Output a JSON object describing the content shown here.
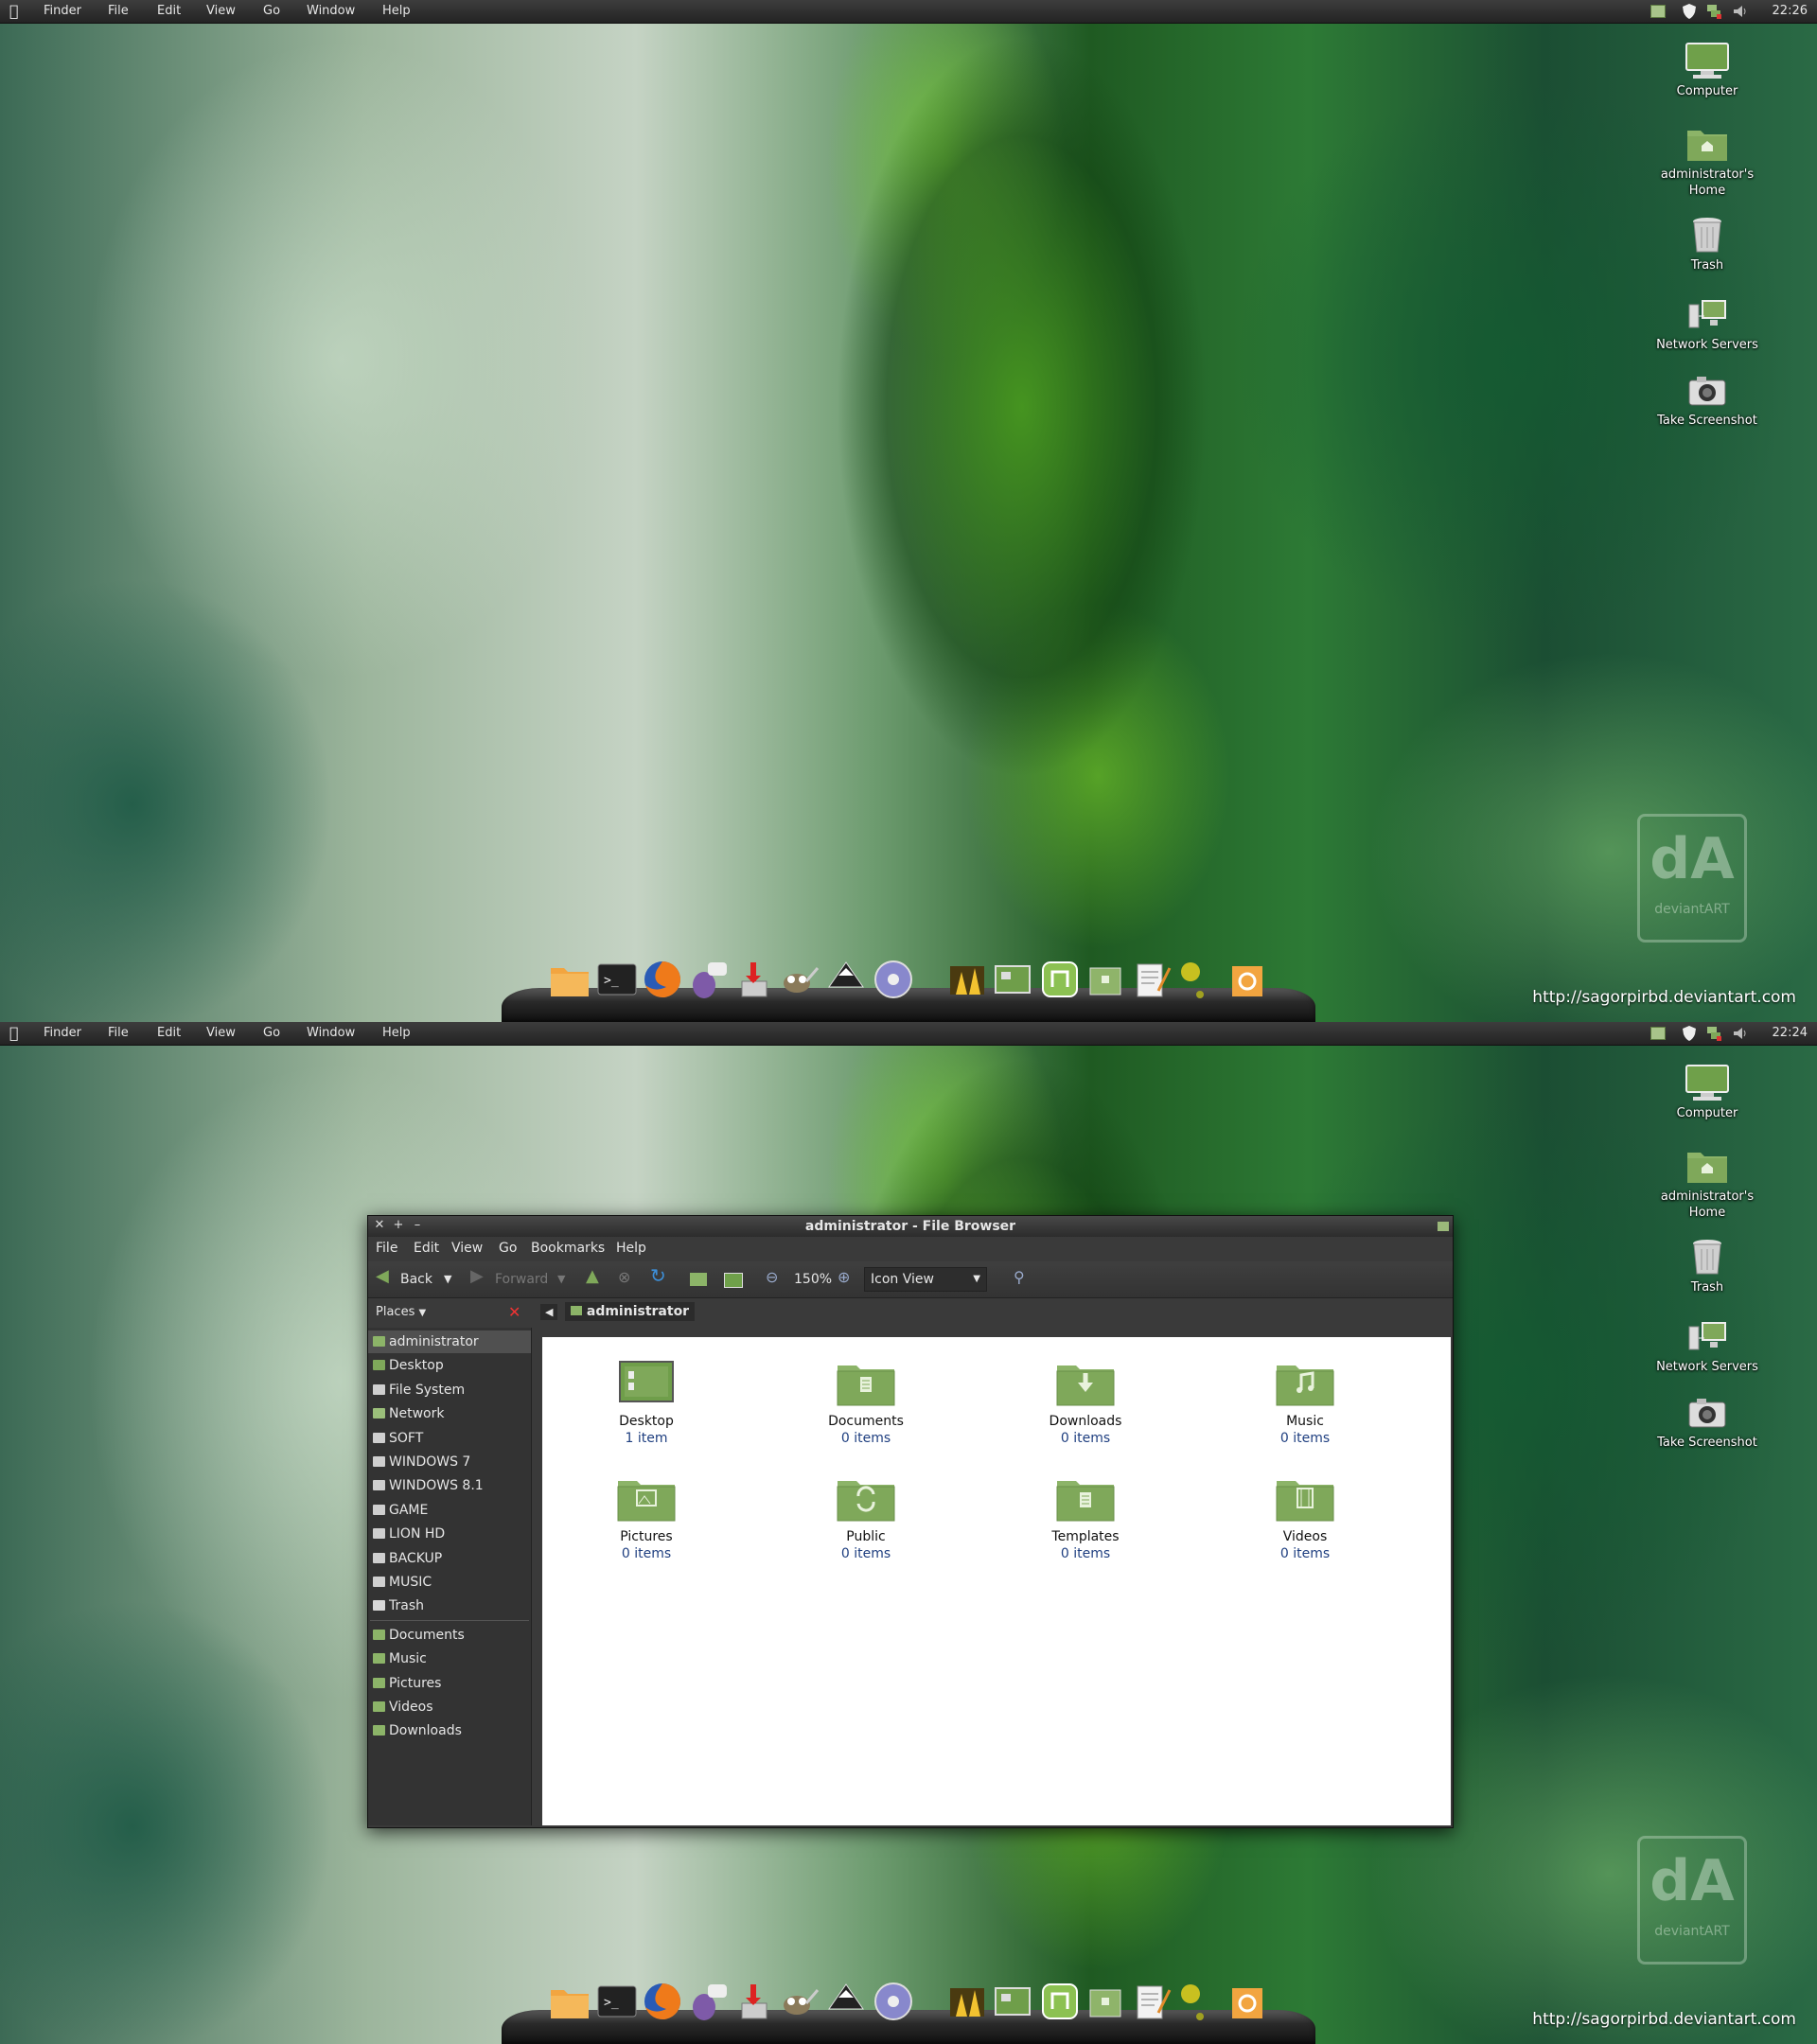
{
  "menubar": {
    "app": "Finder",
    "items": [
      "File",
      "Edit",
      "View",
      "Go",
      "Window",
      "Help"
    ],
    "clock_top": "22:26",
    "clock_bottom": "22:24"
  },
  "desktop_icons": [
    {
      "label": "Computer",
      "icon": "computer-icon"
    },
    {
      "label": "administrator's Home",
      "icon": "home-folder-icon"
    },
    {
      "label": "Trash",
      "icon": "trash-icon"
    },
    {
      "label": "Network Servers",
      "icon": "network-icon"
    },
    {
      "label": "Take Screenshot",
      "icon": "camera-icon"
    }
  ],
  "watermark": {
    "brand": "deviantART"
  },
  "url": "http://sagorpirbd.deviantart.com",
  "dock": [
    "folder",
    "terminal",
    "firefox",
    "pidgin",
    "installer",
    "gimp",
    "inkscape",
    "disc",
    "photo",
    "presentation",
    "mint",
    "archive",
    "text-editor",
    "lamp",
    "recycle"
  ],
  "file_browser": {
    "title": "administrator - File Browser",
    "menu": [
      "File",
      "Edit",
      "View",
      "Go",
      "Bookmarks",
      "Help"
    ],
    "toolbar": {
      "back": "Back",
      "forward": "Forward",
      "zoom": "150%",
      "view_mode": "Icon View"
    },
    "places_label": "Places",
    "location": "administrator",
    "sidebar": [
      {
        "label": "administrator",
        "type": "folder"
      },
      {
        "label": "Desktop",
        "type": "desktop"
      },
      {
        "label": "File System",
        "type": "drive"
      },
      {
        "label": "Network",
        "type": "network"
      },
      {
        "label": "SOFT",
        "type": "drive"
      },
      {
        "label": "WINDOWS 7",
        "type": "drive"
      },
      {
        "label": "WINDOWS 8.1",
        "type": "drive"
      },
      {
        "label": "GAME",
        "type": "drive"
      },
      {
        "label": "LION HD",
        "type": "drive"
      },
      {
        "label": "BACKUP",
        "type": "drive"
      },
      {
        "label": "MUSIC",
        "type": "drive"
      },
      {
        "label": "Trash",
        "type": "trash"
      },
      {
        "label": "Documents",
        "type": "folder"
      },
      {
        "label": "Music",
        "type": "folder"
      },
      {
        "label": "Pictures",
        "type": "folder"
      },
      {
        "label": "Videos",
        "type": "folder"
      },
      {
        "label": "Downloads",
        "type": "folder"
      }
    ],
    "files": [
      {
        "name": "Desktop",
        "count": "1 item",
        "glyph": "desktop"
      },
      {
        "name": "Documents",
        "count": "0 items",
        "glyph": "doc"
      },
      {
        "name": "Downloads",
        "count": "0 items",
        "glyph": "down"
      },
      {
        "name": "Music",
        "count": "0 items",
        "glyph": "note"
      },
      {
        "name": "Pictures",
        "count": "0 items",
        "glyph": "pic"
      },
      {
        "name": "Public",
        "count": "0 items",
        "glyph": "share"
      },
      {
        "name": "Templates",
        "count": "0 items",
        "glyph": "doc"
      },
      {
        "name": "Videos",
        "count": "0 items",
        "glyph": "film"
      }
    ]
  },
  "colors": {
    "accent_green": "#7fa85a",
    "menubar": "#2c2c2c",
    "link": "#1f3f80"
  }
}
